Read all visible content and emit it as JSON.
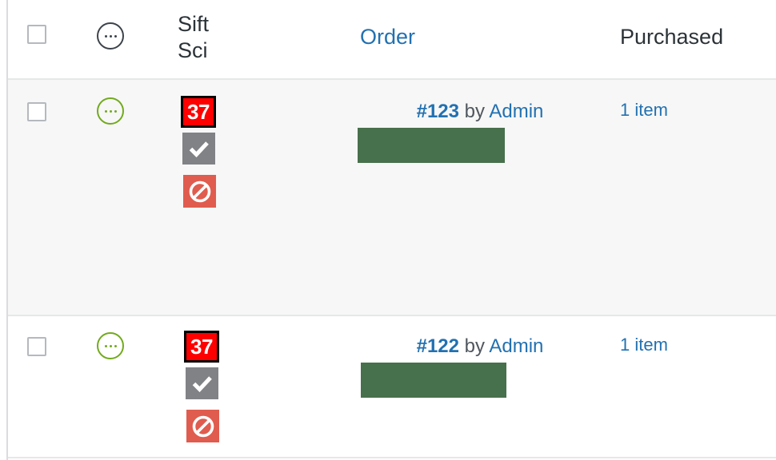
{
  "table": {
    "header": {
      "select_all_checkbox": "select-all",
      "note_icon_label": "...",
      "sift_label_line1": "Sift",
      "sift_label_line2": "Sci",
      "order_label": "Order",
      "purchased_label": "Purchased"
    },
    "rows": [
      {
        "checkbox_checked": false,
        "note_icon_label": "...",
        "sift_score": "37",
        "sift_accept_icon": "checkmark-icon",
        "sift_block_icon": "prohibited-icon",
        "order_number": "#123",
        "order_by": "by",
        "order_customer": "Admin",
        "order_redacted": true,
        "purchased": "1 item"
      },
      {
        "checkbox_checked": false,
        "note_icon_label": "...",
        "sift_score": "37",
        "sift_accept_icon": "checkmark-icon",
        "sift_block_icon": "prohibited-icon",
        "order_number": "#122",
        "order_by": "by",
        "order_customer": "Admin",
        "order_redacted": true,
        "purchased": "1 item"
      }
    ]
  },
  "colors": {
    "link": "#2271b1",
    "text": "#2c3338",
    "muted": "#50575e",
    "score_badge_bg": "#ff0000",
    "score_badge_border": "#000000",
    "accept_badge_bg": "#808285",
    "block_badge_bg": "#e05c4e",
    "note_icon_green": "#72aa1e",
    "note_icon_dark": "#3c434a",
    "redaction": "#47704c",
    "row_alt_bg": "#f7f7f7",
    "row_bg": "#ffffff",
    "rule": "#e6e7e8",
    "checkbox_border": "#b4b9be"
  }
}
